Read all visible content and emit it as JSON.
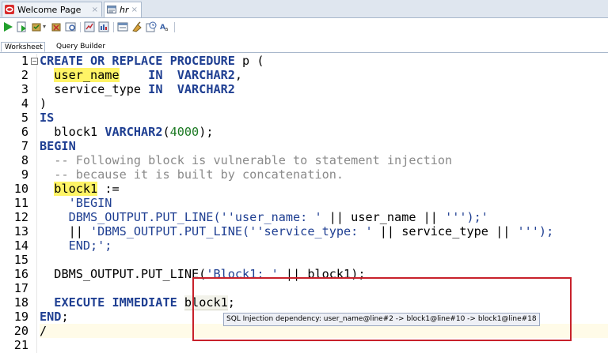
{
  "tabs": [
    {
      "label": "Welcome Page",
      "close": "×",
      "icon": "oracle-icon"
    },
    {
      "label": "hr",
      "close": "×",
      "icon": "sql-worksheet-icon"
    }
  ],
  "toolbar": {
    "icons": [
      "run-statement-icon",
      "run-script-icon",
      "commit-icon",
      "dropdown-arrow-icon",
      "rollback-icon",
      "explain-plan-icon",
      "autotrace-icon",
      "sql-tuning-icon",
      "clear-icon",
      "history-icon",
      "format-icon"
    ]
  },
  "subtabs": {
    "worksheet": "Worksheet",
    "query_builder": "Query Builder"
  },
  "editor": {
    "line_numbers": [
      "1",
      "2",
      "3",
      "4",
      "5",
      "6",
      "7",
      "8",
      "9",
      "10",
      "11",
      "12",
      "13",
      "14",
      "15",
      "16",
      "17",
      "18",
      "19",
      "20",
      "21"
    ],
    "fold_marker": "−",
    "lines": {
      "l1_kw": "CREATE OR REPLACE PROCEDURE",
      "l1_rest": " p (",
      "l2_var": "user_name",
      "l2_sp": "    ",
      "l2_kw": "IN  VARCHAR2",
      "l2_rest": ",",
      "l3_var": "service_type ",
      "l3_kw": "IN  VARCHAR2",
      "l4": ")",
      "l5_kw": "IS",
      "l6_var": "block1 ",
      "l6_kw": "VARCHAR2",
      "l6_open": "(",
      "l6_num": "4000",
      "l6_close": ");",
      "l7_kw": "BEGIN",
      "l8_cmt": "-- Following block is vulnerable to statement injection",
      "l9_cmt": "-- because it is built by concatenation.",
      "l10_var": "block1",
      "l10_rest": " :=",
      "l11_str": "'BEGIN",
      "l12_str": "DBMS_OUTPUT.PUT_LINE(''user_name: '",
      "l12_rest": " || user_name || ",
      "l12_str2": "''');'",
      "l13_rest1": "|| ",
      "l13_str": "'DBMS_OUTPUT.PUT_LINE(''service_type: '",
      "l13_rest2": " || service_type || ",
      "l13_str2": "''');",
      "l14_str": "END;';",
      "l16_rest1": "DBMS_OUTPUT.PUT_LINE(",
      "l16_str": "'Block1: '",
      "l16_rest2": " || block1);",
      "l18_kw": "EXECUTE IMMEDIATE",
      "l18_sp": " ",
      "l18_var": "block1",
      "l18_rest": ";",
      "l19_kw": "END",
      "l19_rest": ";",
      "l20": "/"
    },
    "tooltip": "SQL Injection dependency: user_name@line#2 -> block1@line#10 -> block1@line#18"
  }
}
